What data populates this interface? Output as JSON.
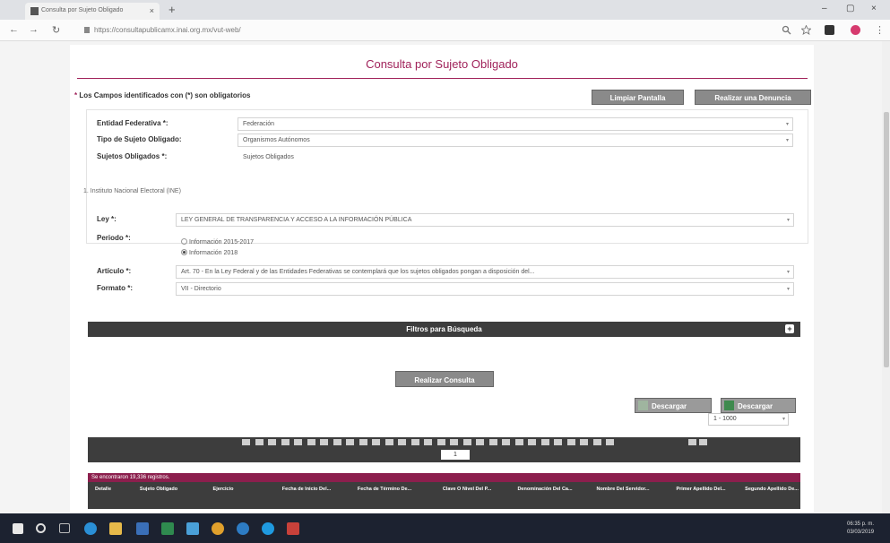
{
  "browser": {
    "tab_title": "Consulta por Sujeto Obligado",
    "tab_close": "×",
    "new_tab": "+",
    "url": "https://consultapublicamx.inai.org.mx/vut-web/",
    "window_controls": [
      "–",
      "▢",
      "×"
    ]
  },
  "page": {
    "title": "Consulta por Sujeto Obligado",
    "required_note_star": "*",
    "required_note": " Los Campos identificados con (*) son obligatorios",
    "clear_button": "Limpiar Pantalla",
    "complaint_button": "Realizar una Denuncia"
  },
  "form": {
    "entidad_label": "Entidad Federativa *:",
    "entidad_value": "Federación",
    "tipo_label": "Tipo de Sujeto Obligado:",
    "tipo_value": "Organismos Autónomos",
    "sujetos_label": "Sujetos Obligados *:",
    "sujetos_value": "Sujetos Obligados",
    "institution": "1. Instituto Nacional Electoral (INE)",
    "ley_label": "Ley *:",
    "ley_value": "LEY GENERAL DE TRANSPARENCIA Y ACCESO A LA INFORMACIÓN PÚBLICA",
    "periodo_label": "Periodo *:",
    "periodo_options": [
      "Información 2015-2017",
      "Información 2018"
    ],
    "periodo_selected": "Información 2018",
    "articulo_label": "Artículo *:",
    "articulo_value": "Art. 70 - En la Ley Federal y de las Entidades Federativas se contemplará que los sujetos obligados pongan a disposición del...",
    "formato_label": "Formato *:",
    "formato_value": "VII - Directorio",
    "dropdown_arrow": "▾"
  },
  "filters": {
    "label": "Filtros para Búsqueda",
    "expand": "+"
  },
  "actions": {
    "consult_button": "Realizar Consulta",
    "download_button_1": "Descargar",
    "download_button_2": "Descargar",
    "rows_range": "1 - 1000"
  },
  "results": {
    "current_page": "1",
    "summary": "Se encontraron 19,336 registros.",
    "columns": [
      "Detalle",
      "Sujeto Obligado",
      "Ejercicio",
      "Fecha de Inicio Del...",
      "Fecha de Término De...",
      "Clave O Nivel Del P...",
      "Denominación Del Ca...",
      "Nombre Del Servidor...",
      "Primer Apellido Del...",
      "Segundo Apellido De..."
    ]
  },
  "taskbar": {
    "time": "06:35 p. m.",
    "date": "03/03/2019"
  },
  "colors": {
    "accent": "#a0225a",
    "dark_bar": "#3d3d3d",
    "summary_bar": "#8c1f4d"
  }
}
